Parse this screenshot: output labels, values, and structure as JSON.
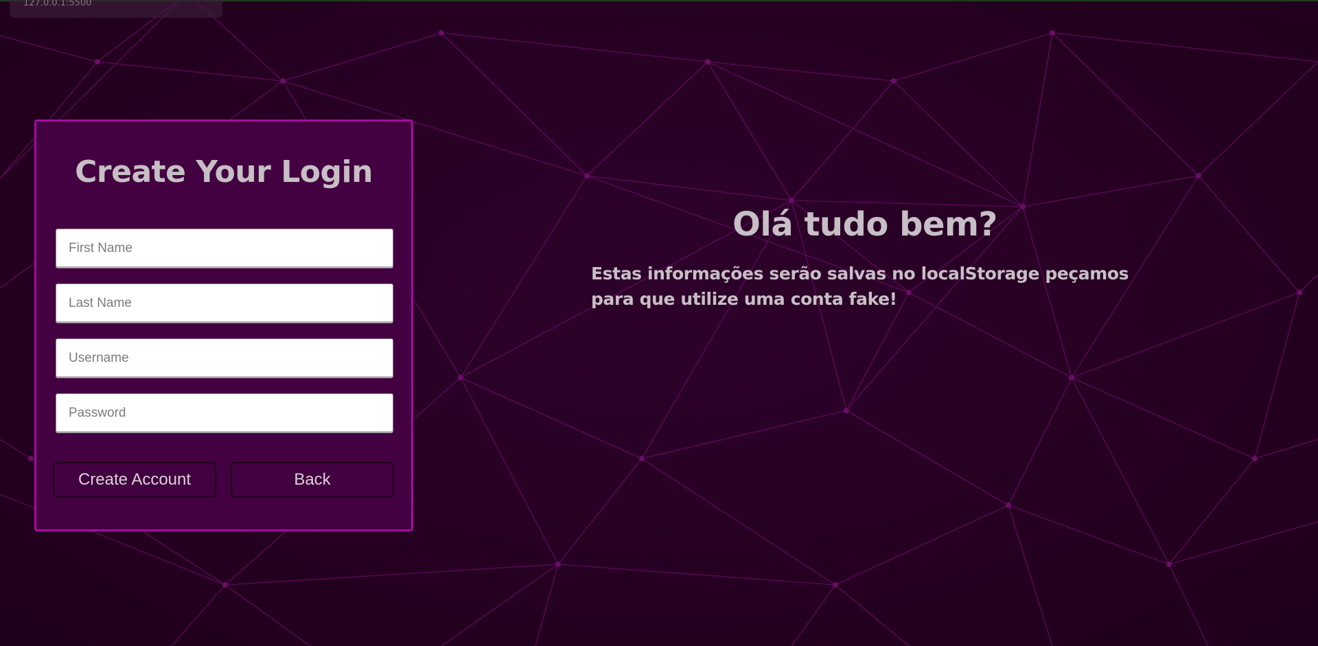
{
  "browser": {
    "url_hint": "127.0.0.1:5500"
  },
  "login": {
    "title": "Create Your Login",
    "fields": {
      "first_name": {
        "placeholder": "First Name",
        "value": ""
      },
      "last_name": {
        "placeholder": "Last Name",
        "value": ""
      },
      "username": {
        "placeholder": "Username",
        "value": ""
      },
      "password": {
        "placeholder": "Password",
        "value": ""
      }
    },
    "buttons": {
      "create": "Create Account",
      "back": "Back"
    }
  },
  "welcome": {
    "title": "Olá tudo bem?",
    "message": "Estas informações serão salvas no localStorage peçamos para que utilize uma conta fake!"
  },
  "colors": {
    "background": "#24001f",
    "mesh_line": "#5c0a5a",
    "card_background": "#430141",
    "card_border": "#a40aa0",
    "button_background": "#420140",
    "text": "#c6bfc5"
  }
}
